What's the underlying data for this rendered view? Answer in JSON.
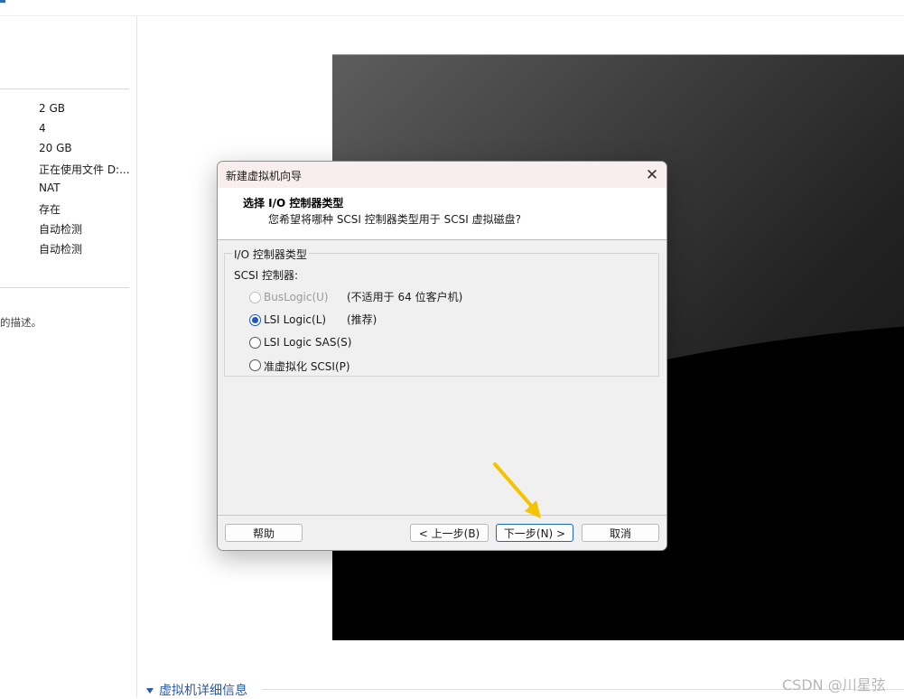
{
  "background": {
    "left_panel_values": [
      "2 GB",
      "4",
      "20 GB",
      "正在使用文件 D:...",
      "NAT",
      "存在",
      "自动检测",
      "自动检测"
    ],
    "description_fragment": "的描述。",
    "details_toggle": "虚拟机详细信息",
    "watermark": "CSDN @川星弦"
  },
  "dialog": {
    "title": "新建虚拟机向导",
    "close_glyph": "✕",
    "header_title": "选择 I/O 控制器类型",
    "header_subtitle": "您希望将哪种 SCSI 控制器类型用于 SCSI 虚拟磁盘?",
    "group_label": "I/O 控制器类型",
    "scsi_label": "SCSI 控制器:",
    "options": [
      {
        "label": "BusLogic(U)",
        "note": "(不适用于 64 位客户机)",
        "state": "disabled"
      },
      {
        "label": "LSI Logic(L)",
        "note": "(推荐)",
        "state": "selected"
      },
      {
        "label": "LSI Logic SAS(S)",
        "note": "",
        "state": "unselected"
      },
      {
        "label": "准虚拟化 SCSI(P)",
        "note": "",
        "state": "unselected"
      }
    ],
    "buttons": {
      "help": "帮助",
      "back": "< 上一步(B)",
      "next": "下一步(N) >",
      "cancel": "取消"
    }
  },
  "annotation": {
    "arrow_color": "#f5c400",
    "target": "next-button"
  },
  "colors": {
    "accent": "#1c57c4",
    "link": "#2a5aa8",
    "titlebar": "#f8eeee"
  }
}
